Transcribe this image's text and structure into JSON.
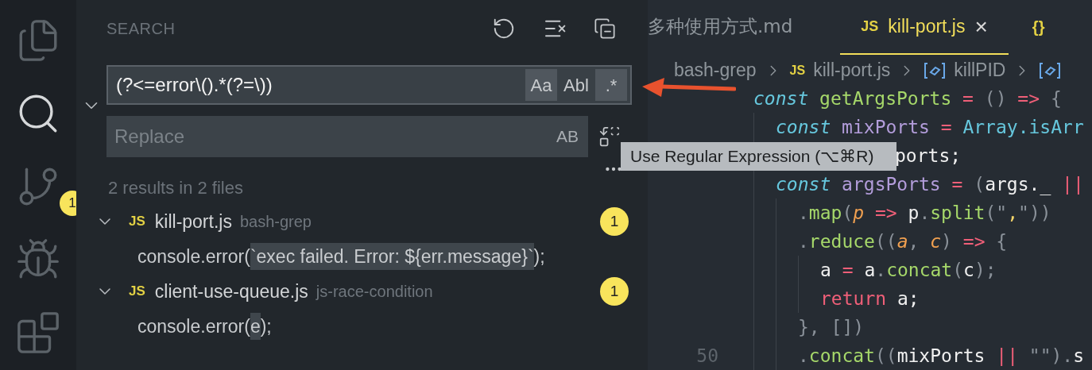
{
  "activity_bar": {
    "items": [
      {
        "kind": "files",
        "selected": false
      },
      {
        "kind": "search",
        "selected": true
      },
      {
        "kind": "source-control",
        "selected": false,
        "badge": "1"
      },
      {
        "kind": "debug",
        "selected": false
      },
      {
        "kind": "extensions",
        "selected": false
      }
    ]
  },
  "search_panel": {
    "title": "SEARCH",
    "search_field": {
      "value": "(?<=error\\().*(?=\\))",
      "options": [
        {
          "label": "Aa",
          "selected": true
        },
        {
          "label": "Abl",
          "selected": false
        },
        {
          "label": ".*",
          "selected": true
        }
      ]
    },
    "replace_field": {
      "placeholder": "Replace",
      "option": "AB"
    },
    "summary": "2 results in 2 files",
    "results": [
      {
        "badge": "JS",
        "file": "kill-port.js",
        "folder": "bash-grep",
        "count": "1",
        "expanded": true,
        "matches": [
          {
            "before": "console.error(",
            "match": "`exec failed. Error: ${err.message}`",
            "after": ");"
          }
        ]
      },
      {
        "badge": "JS",
        "file": "client-use-queue.js",
        "folder": "js-race-condition",
        "count": "1",
        "expanded": true,
        "matches": [
          {
            "before": "console.error(",
            "match": "e",
            "after": ");"
          }
        ]
      }
    ]
  },
  "tooltip": "Use Regular Expression (⌥⌘R)",
  "editor": {
    "tabs": [
      {
        "label": "多种使用方式.md",
        "selected": false,
        "kind": "md"
      },
      {
        "badge": "JS",
        "label": "kill-port.js",
        "selected": true,
        "kind": "js",
        "close": "×"
      },
      {
        "badge": "{}",
        "selected": false,
        "kind": "json"
      }
    ],
    "breadcrumb": [
      {
        "kind": "text",
        "label": "bash-grep"
      },
      {
        "kind": "js",
        "badge": "JS",
        "label": "kill-port.js"
      },
      {
        "kind": "symbol",
        "label": "killPID"
      },
      {
        "kind": "symbol"
      }
    ],
    "lines": [
      {
        "kind": "code",
        "tokens": [
          {
            "kind": "kw",
            "text": "const "
          },
          {
            "kind": "fn",
            "text": "getArgsPorts "
          },
          {
            "kind": "op",
            "text": "= "
          },
          {
            "kind": "punct",
            "text": "() "
          },
          {
            "kind": "op",
            "text": "=> "
          },
          {
            "kind": "punct",
            "text": "{"
          }
        ],
        "children": [
          {
            "kind": "code",
            "tokens": [
              {
                "kind": "kw",
                "text": "const "
              },
              {
                "kind": "var",
                "text": "mixPorts "
              },
              {
                "kind": "op",
                "text": "= "
              },
              {
                "kind": "type",
                "text": "Array.isArr"
              }
            ]
          },
          {
            "kind": "covered",
            "tokens": [
              {
                "kind": "plain",
                "text": "ports;"
              }
            ]
          },
          {
            "kind": "code",
            "tokens": [
              {
                "kind": "kw",
                "text": "const "
              },
              {
                "kind": "var",
                "text": "argsPorts "
              },
              {
                "kind": "op",
                "text": "= "
              },
              {
                "kind": "punct",
                "text": "("
              },
              {
                "kind": "plain",
                "text": "args._ "
              },
              {
                "kind": "op",
                "text": "||"
              }
            ],
            "children": [
              {
                "kind": "code",
                "tokens": [
                  {
                    "kind": "punct",
                    "text": "."
                  },
                  {
                    "kind": "fn",
                    "text": "map"
                  },
                  {
                    "kind": "punct",
                    "text": "("
                  },
                  {
                    "kind": "param",
                    "text": "p "
                  },
                  {
                    "kind": "op",
                    "text": "=> "
                  },
                  {
                    "kind": "plain",
                    "text": "p"
                  },
                  {
                    "kind": "punct",
                    "text": "."
                  },
                  {
                    "kind": "fn",
                    "text": "split"
                  },
                  {
                    "kind": "punct",
                    "text": "(\""
                  },
                  {
                    "kind": "str",
                    "text": ","
                  },
                  {
                    "kind": "punct",
                    "text": "\"))"
                  }
                ]
              },
              {
                "kind": "code",
                "tokens": [
                  {
                    "kind": "punct",
                    "text": "."
                  },
                  {
                    "kind": "fn",
                    "text": "reduce"
                  },
                  {
                    "kind": "punct",
                    "text": "(("
                  },
                  {
                    "kind": "param",
                    "text": "a"
                  },
                  {
                    "kind": "punct",
                    "text": ", "
                  },
                  {
                    "kind": "param",
                    "text": "c"
                  },
                  {
                    "kind": "punct",
                    "text": ") "
                  },
                  {
                    "kind": "op",
                    "text": "=> "
                  },
                  {
                    "kind": "punct",
                    "text": "{"
                  }
                ],
                "children": [
                  {
                    "kind": "code",
                    "tokens": [
                      {
                        "kind": "plain",
                        "text": "a "
                      },
                      {
                        "kind": "op",
                        "text": "= "
                      },
                      {
                        "kind": "plain",
                        "text": "a"
                      },
                      {
                        "kind": "punct",
                        "text": "."
                      },
                      {
                        "kind": "fn",
                        "text": "concat"
                      },
                      {
                        "kind": "punct",
                        "text": "("
                      },
                      {
                        "kind": "plain",
                        "text": "c"
                      },
                      {
                        "kind": "punct",
                        "text": ");"
                      }
                    ]
                  },
                  {
                    "kind": "code",
                    "tokens": [
                      {
                        "kind": "ret",
                        "text": "return "
                      },
                      {
                        "kind": "plain",
                        "text": "a;"
                      }
                    ]
                  }
                ]
              },
              {
                "kind": "code",
                "tokens": [
                  {
                    "kind": "punct",
                    "text": "}, [])"
                  }
                ]
              },
              {
                "kind": "code",
                "number": "50",
                "tokens": [
                  {
                    "kind": "punct",
                    "text": "."
                  },
                  {
                    "kind": "fn",
                    "text": "concat"
                  },
                  {
                    "kind": "punct",
                    "text": "(("
                  },
                  {
                    "kind": "plain",
                    "text": "mixPorts "
                  },
                  {
                    "kind": "op",
                    "text": "|| "
                  },
                  {
                    "kind": "punct",
                    "text": "\"\")."
                  },
                  {
                    "kind": "plain",
                    "text": "s"
                  }
                ]
              }
            ]
          }
        ]
      }
    ]
  }
}
